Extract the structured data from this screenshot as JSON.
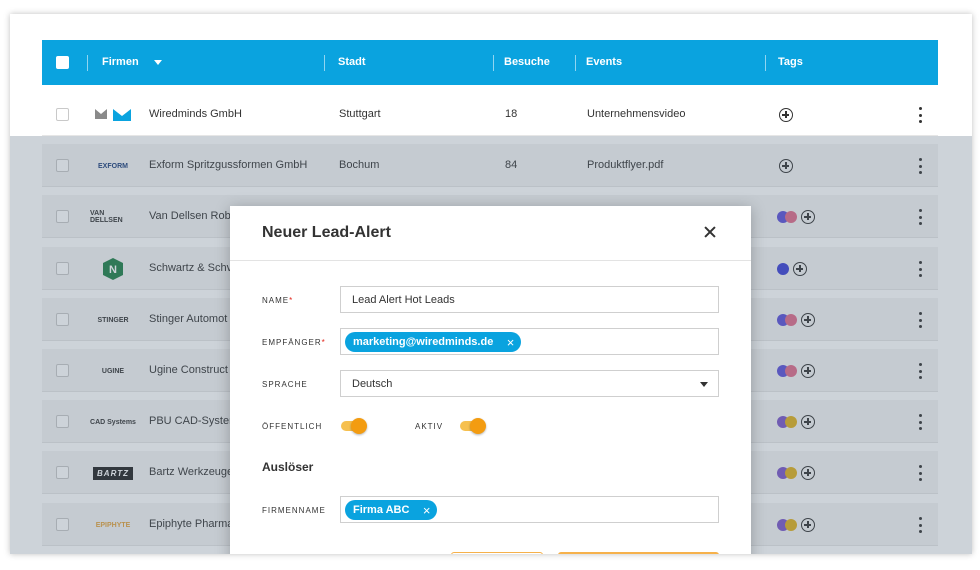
{
  "table": {
    "columns": {
      "firmen": "Firmen",
      "stadt": "Stadt",
      "besuche": "Besuche",
      "events": "Events",
      "tags": "Tags"
    },
    "rows": [
      {
        "logo": "wiredminds-logo",
        "name": "Wiredminds GmbH",
        "city": "Stuttgart",
        "visits": "18",
        "event": "Unternehmensvideo",
        "tags": []
      },
      {
        "logo": "exform-logo",
        "logo_text": "EXFORM",
        "name": "Exform Spritzgussformen GmbH",
        "city": "Bochum",
        "visits": "84",
        "event": "Produktflyer.pdf",
        "tags": []
      },
      {
        "logo": "van-dellsen-logo",
        "logo_text": "VAN DELLSEN",
        "name": "Van Dellsen Rob",
        "tags": [
          "#5b4fd8",
          "#e06a8a"
        ]
      },
      {
        "logo": "schwartz-logo",
        "name": "Schwartz & Schv",
        "tags": [
          "#3b3fd6"
        ]
      },
      {
        "logo": "stinger-logo",
        "logo_text": "STINGER",
        "name": "Stinger Automot",
        "tags": [
          "#5b4fd8",
          "#e06a8a"
        ]
      },
      {
        "logo": "ugine-logo",
        "logo_text": "UGINE",
        "name": "Ugine Construct",
        "tags": [
          "#5b4fd8",
          "#e06a8a"
        ]
      },
      {
        "logo": "cad-systems-logo",
        "logo_text": "CAD Systems",
        "name": "PBU CAD-Syster",
        "tags": [
          "#7a55c8",
          "#e0b01a"
        ]
      },
      {
        "logo": "bartz-logo",
        "logo_text": "BARTZ",
        "name": "Bartz Werkzeuge",
        "tags": [
          "#7a55c8",
          "#e0b01a"
        ]
      },
      {
        "logo": "epiphyte-logo",
        "logo_text": "EPIPHYTE",
        "name": "Epiphyte Pharma",
        "tags": [
          "#7a55c8",
          "#e0b01a"
        ]
      }
    ]
  },
  "modal": {
    "title": "Neuer Lead-Alert",
    "name_label": "Name",
    "name_value": "Lead Alert Hot Leads",
    "recipient_label": "Empfänger",
    "recipient_chip": "marketing@wiredminds.de",
    "language_label": "Sprache",
    "language_value": "Deutsch",
    "public_label": "Öffentlich",
    "public_on": true,
    "active_label": "Aktiv",
    "active_on": true,
    "trigger_section": "Auslöser",
    "company_label": "Firmenname",
    "company_chip": "Firma ABC",
    "required_mark": "*",
    "chip_remove": "×"
  },
  "colors": {
    "header": "#0aa3df",
    "accent": "#f39c11",
    "chip": "#0aa3df"
  }
}
